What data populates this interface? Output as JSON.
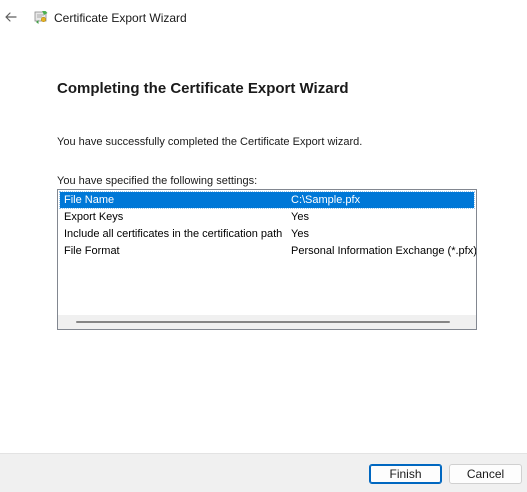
{
  "window": {
    "title": "Certificate Export Wizard"
  },
  "page": {
    "heading": "Completing the Certificate Export Wizard",
    "success_message": "You have successfully completed the Certificate Export wizard.",
    "settings_label": "You have specified the following settings:"
  },
  "settings": [
    {
      "name": "File Name",
      "value": "C:\\Sample.pfx",
      "selected": true
    },
    {
      "name": "Export Keys",
      "value": "Yes",
      "selected": false
    },
    {
      "name": "Include all certificates in the certification path",
      "value": "Yes",
      "selected": false
    },
    {
      "name": "File Format",
      "value": "Personal Information Exchange (*.pfx)",
      "selected": false
    }
  ],
  "buttons": {
    "finish": "Finish",
    "cancel": "Cancel"
  },
  "icons": {
    "back": "back-arrow-icon",
    "app": "certificate-icon"
  },
  "colors": {
    "selection": "#0078d7",
    "default_button_border": "#0067c0"
  }
}
